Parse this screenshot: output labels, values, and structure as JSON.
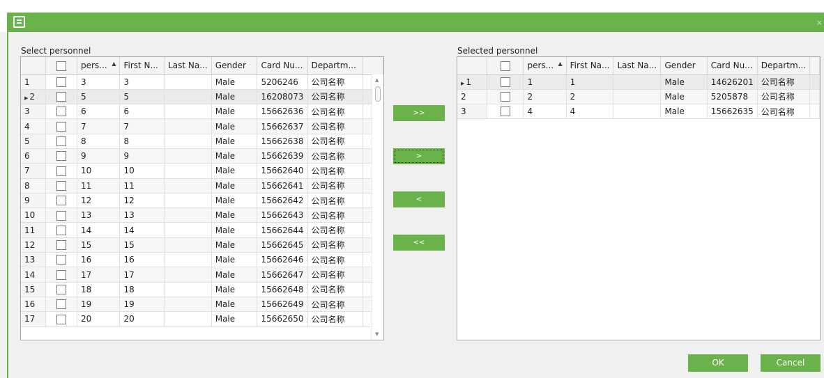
{
  "window": {
    "close_glyph": "×"
  },
  "left": {
    "label": "Select personnel",
    "headers": [
      "pers...",
      "First N...",
      "Last Na...",
      "Gender",
      "Card Nu...",
      "Departm..."
    ],
    "current_row_index": 1,
    "rows": [
      {
        "num": "1",
        "pers": "3",
        "first": "3",
        "last": "",
        "gender": "Male",
        "card": "5206246",
        "dept": "公司名称"
      },
      {
        "num": "2",
        "pers": "5",
        "first": "5",
        "last": "",
        "gender": "Male",
        "card": "16208073",
        "dept": "公司名称"
      },
      {
        "num": "3",
        "pers": "6",
        "first": "6",
        "last": "",
        "gender": "Male",
        "card": "15662636",
        "dept": "公司名称"
      },
      {
        "num": "4",
        "pers": "7",
        "first": "7",
        "last": "",
        "gender": "Male",
        "card": "15662637",
        "dept": "公司名称"
      },
      {
        "num": "5",
        "pers": "8",
        "first": "8",
        "last": "",
        "gender": "Male",
        "card": "15662638",
        "dept": "公司名称"
      },
      {
        "num": "6",
        "pers": "9",
        "first": "9",
        "last": "",
        "gender": "Male",
        "card": "15662639",
        "dept": "公司名称"
      },
      {
        "num": "7",
        "pers": "10",
        "first": "10",
        "last": "",
        "gender": "Male",
        "card": "15662640",
        "dept": "公司名称"
      },
      {
        "num": "8",
        "pers": "11",
        "first": "11",
        "last": "",
        "gender": "Male",
        "card": "15662641",
        "dept": "公司名称"
      },
      {
        "num": "9",
        "pers": "12",
        "first": "12",
        "last": "",
        "gender": "Male",
        "card": "15662642",
        "dept": "公司名称"
      },
      {
        "num": "10",
        "pers": "13",
        "first": "13",
        "last": "",
        "gender": "Male",
        "card": "15662643",
        "dept": "公司名称"
      },
      {
        "num": "11",
        "pers": "14",
        "first": "14",
        "last": "",
        "gender": "Male",
        "card": "15662644",
        "dept": "公司名称"
      },
      {
        "num": "12",
        "pers": "15",
        "first": "15",
        "last": "",
        "gender": "Male",
        "card": "15662645",
        "dept": "公司名称"
      },
      {
        "num": "13",
        "pers": "16",
        "first": "16",
        "last": "",
        "gender": "Male",
        "card": "15662646",
        "dept": "公司名称"
      },
      {
        "num": "14",
        "pers": "17",
        "first": "17",
        "last": "",
        "gender": "Male",
        "card": "15662647",
        "dept": "公司名称"
      },
      {
        "num": "15",
        "pers": "18",
        "first": "18",
        "last": "",
        "gender": "Male",
        "card": "15662648",
        "dept": "公司名称"
      },
      {
        "num": "16",
        "pers": "19",
        "first": "19",
        "last": "",
        "gender": "Male",
        "card": "15662649",
        "dept": "公司名称"
      },
      {
        "num": "17",
        "pers": "20",
        "first": "20",
        "last": "",
        "gender": "Male",
        "card": "15662650",
        "dept": "公司名称"
      }
    ]
  },
  "transfer": {
    "add_all": ">>",
    "add_one": ">",
    "remove_one": "<",
    "remove_all": "<<"
  },
  "right": {
    "label": "Selected personnel",
    "headers": [
      "pers...",
      "First Na...",
      "Last Na...",
      "Gender",
      "Card Nu...",
      "Departm..."
    ],
    "current_row_index": 0,
    "rows": [
      {
        "num": "1",
        "pers": "1",
        "first": "1",
        "last": "",
        "gender": "Male",
        "card": "14626201",
        "dept": "公司名称"
      },
      {
        "num": "2",
        "pers": "2",
        "first": "2",
        "last": "",
        "gender": "Male",
        "card": "5205878",
        "dept": "公司名称"
      },
      {
        "num": "3",
        "pers": "4",
        "first": "4",
        "last": "",
        "gender": "Male",
        "card": "15662635",
        "dept": "公司名称"
      }
    ]
  },
  "footer": {
    "ok": "OK",
    "cancel": "Cancel"
  },
  "colors": {
    "accent": "#6ab34a"
  }
}
